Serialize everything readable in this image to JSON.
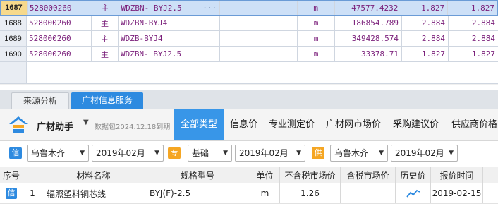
{
  "grid": {
    "rows": [
      {
        "idx": "1687",
        "code": "528000260",
        "main": "主",
        "spec": "WDZBN- BYJ2.5",
        "dots": "···",
        "unit": "m",
        "qty": "47577.4232",
        "p1": "1.827",
        "p2": "1.827"
      },
      {
        "idx": "1688",
        "code": "528000260",
        "main": "主",
        "spec": "WDZBN-BYJ4",
        "dots": "",
        "unit": "m",
        "qty": "186854.789",
        "p1": "2.884",
        "p2": "2.884"
      },
      {
        "idx": "1689",
        "code": "528000260",
        "main": "主",
        "spec": "WDZB-BYJ4",
        "dots": "",
        "unit": "m",
        "qty": "349428.574",
        "p1": "2.884",
        "p2": "2.884"
      },
      {
        "idx": "1690",
        "code": "528000260",
        "main": "主",
        "spec": "WDZBN-  BYJ2.5",
        "dots": "",
        "unit": "m",
        "qty": "33378.71",
        "p1": "1.827",
        "p2": "1.827"
      }
    ]
  },
  "tabs": [
    "来源分析",
    "广材信息服务"
  ],
  "assistant": {
    "title": "广材助手",
    "caret": "▼",
    "package_date": "数据包2024.12.18到期",
    "nav": [
      "全部类型",
      "信息价",
      "专业测定价",
      "广材网市场价",
      "采购建议价",
      "供应商价格"
    ]
  },
  "filters": {
    "xin_badge": "信",
    "region1": "乌鲁木齐",
    "month1": "2019年02月",
    "zhuan_badge": "专",
    "type": "基础",
    "month2": "2019年02月",
    "gong_badge": "供",
    "region2": "乌鲁木齐",
    "month3": "2019年02月"
  },
  "table": {
    "headers": [
      "序号",
      "材料名称",
      "规格型号",
      "单位",
      "不含税市场价",
      "含税市场价",
      "历史价",
      "报价时间"
    ],
    "rows": [
      {
        "badge": "信",
        "no": "1",
        "name": "辐照塑料铜芯线",
        "spec": "BYJ(F)-2.5",
        "unit": "m",
        "price_ex": "1.26",
        "price_in": "",
        "time": "2019-02-15"
      }
    ]
  },
  "colors": {
    "accent": "#2d8ae0",
    "nav_selected": "#3896e8",
    "grid_text": "#7a1f7a",
    "badge_orange": "#f5a623"
  }
}
